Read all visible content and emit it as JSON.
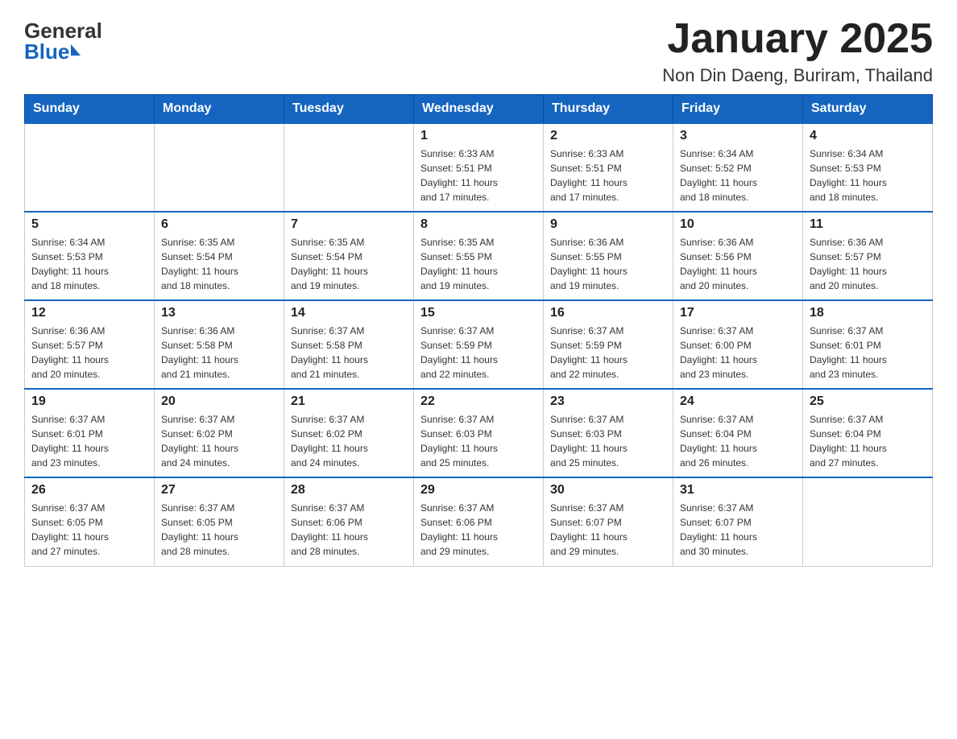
{
  "logo": {
    "general": "General",
    "blue": "Blue"
  },
  "title": "January 2025",
  "location": "Non Din Daeng, Buriram, Thailand",
  "days_of_week": [
    "Sunday",
    "Monday",
    "Tuesday",
    "Wednesday",
    "Thursday",
    "Friday",
    "Saturday"
  ],
  "weeks": [
    [
      {
        "day": "",
        "info": ""
      },
      {
        "day": "",
        "info": ""
      },
      {
        "day": "",
        "info": ""
      },
      {
        "day": "1",
        "info": "Sunrise: 6:33 AM\nSunset: 5:51 PM\nDaylight: 11 hours\nand 17 minutes."
      },
      {
        "day": "2",
        "info": "Sunrise: 6:33 AM\nSunset: 5:51 PM\nDaylight: 11 hours\nand 17 minutes."
      },
      {
        "day": "3",
        "info": "Sunrise: 6:34 AM\nSunset: 5:52 PM\nDaylight: 11 hours\nand 18 minutes."
      },
      {
        "day": "4",
        "info": "Sunrise: 6:34 AM\nSunset: 5:53 PM\nDaylight: 11 hours\nand 18 minutes."
      }
    ],
    [
      {
        "day": "5",
        "info": "Sunrise: 6:34 AM\nSunset: 5:53 PM\nDaylight: 11 hours\nand 18 minutes."
      },
      {
        "day": "6",
        "info": "Sunrise: 6:35 AM\nSunset: 5:54 PM\nDaylight: 11 hours\nand 18 minutes."
      },
      {
        "day": "7",
        "info": "Sunrise: 6:35 AM\nSunset: 5:54 PM\nDaylight: 11 hours\nand 19 minutes."
      },
      {
        "day": "8",
        "info": "Sunrise: 6:35 AM\nSunset: 5:55 PM\nDaylight: 11 hours\nand 19 minutes."
      },
      {
        "day": "9",
        "info": "Sunrise: 6:36 AM\nSunset: 5:55 PM\nDaylight: 11 hours\nand 19 minutes."
      },
      {
        "day": "10",
        "info": "Sunrise: 6:36 AM\nSunset: 5:56 PM\nDaylight: 11 hours\nand 20 minutes."
      },
      {
        "day": "11",
        "info": "Sunrise: 6:36 AM\nSunset: 5:57 PM\nDaylight: 11 hours\nand 20 minutes."
      }
    ],
    [
      {
        "day": "12",
        "info": "Sunrise: 6:36 AM\nSunset: 5:57 PM\nDaylight: 11 hours\nand 20 minutes."
      },
      {
        "day": "13",
        "info": "Sunrise: 6:36 AM\nSunset: 5:58 PM\nDaylight: 11 hours\nand 21 minutes."
      },
      {
        "day": "14",
        "info": "Sunrise: 6:37 AM\nSunset: 5:58 PM\nDaylight: 11 hours\nand 21 minutes."
      },
      {
        "day": "15",
        "info": "Sunrise: 6:37 AM\nSunset: 5:59 PM\nDaylight: 11 hours\nand 22 minutes."
      },
      {
        "day": "16",
        "info": "Sunrise: 6:37 AM\nSunset: 5:59 PM\nDaylight: 11 hours\nand 22 minutes."
      },
      {
        "day": "17",
        "info": "Sunrise: 6:37 AM\nSunset: 6:00 PM\nDaylight: 11 hours\nand 23 minutes."
      },
      {
        "day": "18",
        "info": "Sunrise: 6:37 AM\nSunset: 6:01 PM\nDaylight: 11 hours\nand 23 minutes."
      }
    ],
    [
      {
        "day": "19",
        "info": "Sunrise: 6:37 AM\nSunset: 6:01 PM\nDaylight: 11 hours\nand 23 minutes."
      },
      {
        "day": "20",
        "info": "Sunrise: 6:37 AM\nSunset: 6:02 PM\nDaylight: 11 hours\nand 24 minutes."
      },
      {
        "day": "21",
        "info": "Sunrise: 6:37 AM\nSunset: 6:02 PM\nDaylight: 11 hours\nand 24 minutes."
      },
      {
        "day": "22",
        "info": "Sunrise: 6:37 AM\nSunset: 6:03 PM\nDaylight: 11 hours\nand 25 minutes."
      },
      {
        "day": "23",
        "info": "Sunrise: 6:37 AM\nSunset: 6:03 PM\nDaylight: 11 hours\nand 25 minutes."
      },
      {
        "day": "24",
        "info": "Sunrise: 6:37 AM\nSunset: 6:04 PM\nDaylight: 11 hours\nand 26 minutes."
      },
      {
        "day": "25",
        "info": "Sunrise: 6:37 AM\nSunset: 6:04 PM\nDaylight: 11 hours\nand 27 minutes."
      }
    ],
    [
      {
        "day": "26",
        "info": "Sunrise: 6:37 AM\nSunset: 6:05 PM\nDaylight: 11 hours\nand 27 minutes."
      },
      {
        "day": "27",
        "info": "Sunrise: 6:37 AM\nSunset: 6:05 PM\nDaylight: 11 hours\nand 28 minutes."
      },
      {
        "day": "28",
        "info": "Sunrise: 6:37 AM\nSunset: 6:06 PM\nDaylight: 11 hours\nand 28 minutes."
      },
      {
        "day": "29",
        "info": "Sunrise: 6:37 AM\nSunset: 6:06 PM\nDaylight: 11 hours\nand 29 minutes."
      },
      {
        "day": "30",
        "info": "Sunrise: 6:37 AM\nSunset: 6:07 PM\nDaylight: 11 hours\nand 29 minutes."
      },
      {
        "day": "31",
        "info": "Sunrise: 6:37 AM\nSunset: 6:07 PM\nDaylight: 11 hours\nand 30 minutes."
      },
      {
        "day": "",
        "info": ""
      }
    ]
  ]
}
